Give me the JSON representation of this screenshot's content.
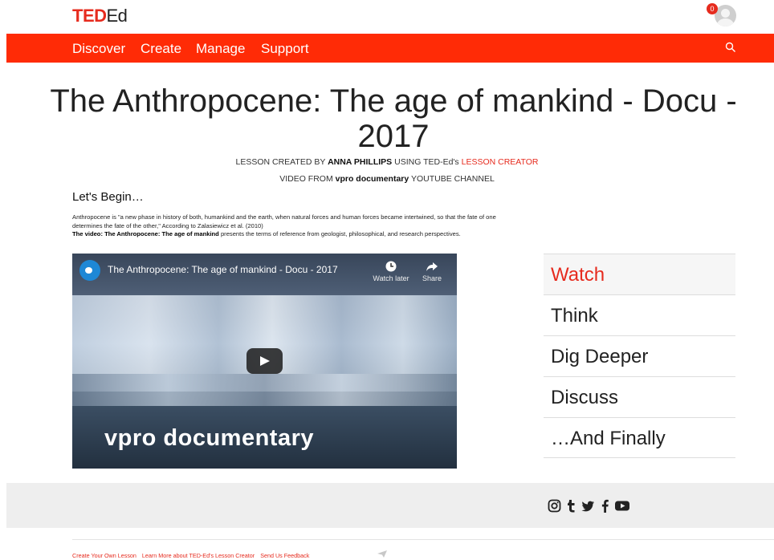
{
  "header": {
    "logo_ted": "TED",
    "logo_ed": "Ed",
    "notifications": "0"
  },
  "nav": {
    "items": [
      "Discover",
      "Create",
      "Manage",
      "Support"
    ]
  },
  "lesson": {
    "title": "The Anthropocene: The age of mankind - Docu - 2017",
    "created_prefix": "LESSON CREATED BY ",
    "author": "ANNA PHILLIPS",
    "using": " USING TED-Ed's ",
    "creator_link": "LESSON CREATOR",
    "video_prefix": "VIDEO FROM ",
    "channel": "vpro documentary",
    "video_suffix": " YOUTUBE CHANNEL"
  },
  "intro": {
    "heading": "Let's Begin…",
    "paragraph": "Anthropocene is \"a new phase in history of both, humankind and the earth, when natural forces and human forces became intertwined, so that the fate of one determines the fate of the other,\" According to Zalasiewicz et al. (2010)",
    "video_label": "The video: The Anthropocene: The age of mankind",
    "video_desc": " presents the terms of reference from geologist, philosophical, and research perspectives."
  },
  "video": {
    "title": "The Anthropocene: The age of mankind - Docu - 2017",
    "watch_later": "Watch later",
    "share": "Share",
    "brand": "vpro documentary"
  },
  "sidebar": {
    "items": [
      "Watch",
      "Think",
      "Dig Deeper",
      "Discuss",
      "…And Finally"
    ],
    "active": "Watch"
  },
  "footer": {
    "social_icons": [
      "instagram-icon",
      "tumblr-icon",
      "twitter-icon",
      "facebook-icon",
      "youtube-icon"
    ],
    "links": [
      "Create Your Own Lesson",
      "Learn More about TED-Ed's Lesson Creator",
      "Send Us Feedback"
    ]
  },
  "colors": {
    "accent": "#e62b1e",
    "navbar": "#ff2b06"
  }
}
